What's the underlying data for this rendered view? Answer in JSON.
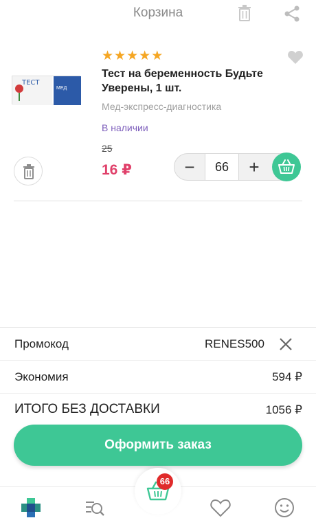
{
  "header": {
    "title": "Корзина",
    "trash_icon": "trash-icon",
    "share_icon": "share-icon"
  },
  "product": {
    "rating": 5,
    "name": "Тест на беременность Будьте Уверены, 1 шт.",
    "manufacturer": "Мед-экспресс-диагностика",
    "stock": "В наличии",
    "old_price": "25",
    "price": "16 ₽",
    "quantity": "66",
    "package_text": "ТЕСТ",
    "package_brand": "МЕД",
    "colors": {
      "price": "#e0406a",
      "stock": "#7c5dbb",
      "accent": "#3ec795"
    }
  },
  "summary": {
    "promo_label": "Промокод",
    "promo_value": "RENES500",
    "savings_label": "Экономия",
    "savings_value": "594 ₽",
    "total_label": "ИТОГО БЕЗ ДОСТАВКИ",
    "total_value": "1056 ₽"
  },
  "order_button": "Оформить заказ",
  "tabbar": {
    "items": [
      "home-cross-icon",
      "catalog-search-icon",
      "cart-icon",
      "heart-icon",
      "profile-smile-icon"
    ],
    "cart_badge": "66"
  }
}
